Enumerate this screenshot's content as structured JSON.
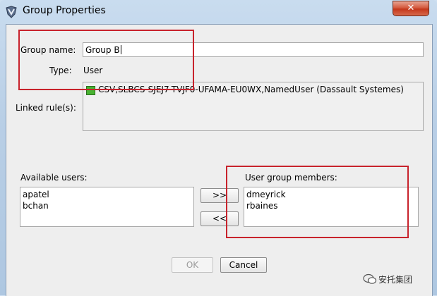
{
  "window": {
    "title": "Group Properties",
    "close_glyph": "✕"
  },
  "form": {
    "group_name_label": "Group name:",
    "group_name_value": "Group B",
    "type_label": "Type:",
    "type_value": "User",
    "linked_rules_label": "Linked rule(s):",
    "linked_rules": [
      "CSV,SLBCS-SJEJ7-TVJF0-UFAMA-EU0WX,NamedUser (Dassault Systemes)"
    ]
  },
  "available": {
    "label": "Available users:",
    "items": [
      "apatel",
      "bchan"
    ]
  },
  "members": {
    "label": "User group members:",
    "items": [
      "dmeyrick",
      "rbaines"
    ]
  },
  "transfer": {
    "add_label": ">>",
    "remove_label": "<<"
  },
  "footer": {
    "ok_label": "OK",
    "cancel_label": "Cancel"
  },
  "watermark": {
    "text": "安托集团"
  },
  "colors": {
    "highlight_box": "#c8232c",
    "rule_icon": "#48b332"
  }
}
